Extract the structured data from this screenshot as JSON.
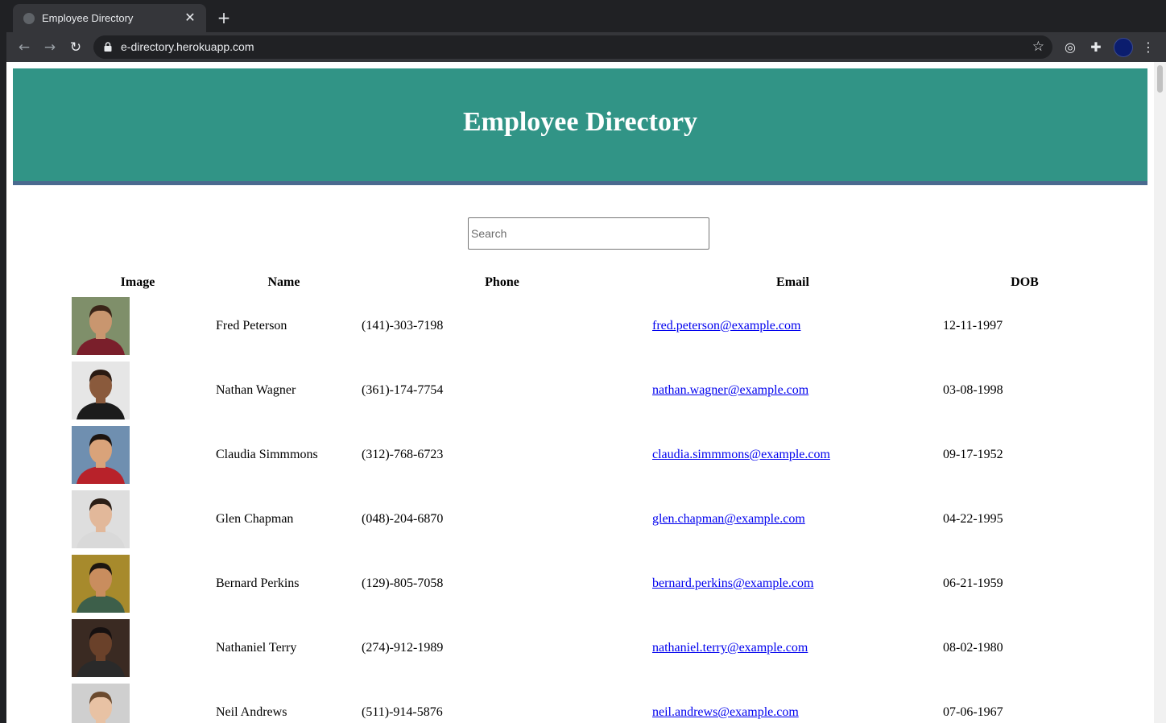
{
  "browser": {
    "tab_title": "Employee Directory",
    "url": "e-directory.herokuapp.com"
  },
  "page": {
    "heading": "Employee Directory",
    "search_placeholder": "Search",
    "columns": [
      "Image",
      "Name",
      "Phone",
      "Email",
      "DOB"
    ],
    "employees": [
      {
        "name": "Fred Peterson",
        "phone": "(141)-303-7198",
        "email": "fred.peterson@example.com",
        "dob": "12-11-1997",
        "skin": "#c9966f",
        "hair": "#3a2418",
        "shirt": "#7a1f2b",
        "bg": "#7f8f6a"
      },
      {
        "name": "Nathan Wagner",
        "phone": "(361)-174-7754",
        "email": "nathan.wagner@example.com",
        "dob": "03-08-1998",
        "skin": "#8a5a3c",
        "hair": "#2a1a12",
        "shirt": "#1b1b1b",
        "bg": "#e6e6e6"
      },
      {
        "name": "Claudia Simmmons",
        "phone": "(312)-768-6723",
        "email": "claudia.simmmons@example.com",
        "dob": "09-17-1952",
        "skin": "#d9a37a",
        "hair": "#1c1410",
        "shirt": "#b8222a",
        "bg": "#6f8fb0"
      },
      {
        "name": "Glen Chapman",
        "phone": "(048)-204-6870",
        "email": "glen.chapman@example.com",
        "dob": "04-22-1995",
        "skin": "#e2b89a",
        "hair": "#2b1e16",
        "shirt": "#d9d9d9",
        "bg": "#dedede"
      },
      {
        "name": "Bernard Perkins",
        "phone": "(129)-805-7058",
        "email": "bernard.perkins@example.com",
        "dob": "06-21-1959",
        "skin": "#c98d5e",
        "hair": "#1d1610",
        "shirt": "#3d5f4a",
        "bg": "#a78a2c"
      },
      {
        "name": "Nathaniel Terry",
        "phone": "(274)-912-1989",
        "email": "nathaniel.terry@example.com",
        "dob": "08-02-1980",
        "skin": "#6a412a",
        "hair": "#161010",
        "shirt": "#2a2a2a",
        "bg": "#3a2a22"
      },
      {
        "name": "Neil Andrews",
        "phone": "(511)-914-5876",
        "email": "neil.andrews@example.com",
        "dob": "07-06-1967",
        "skin": "#e8c2a4",
        "hair": "#6b4a2e",
        "shirt": "#d8d0c0",
        "bg": "#cfcfcf"
      }
    ]
  }
}
